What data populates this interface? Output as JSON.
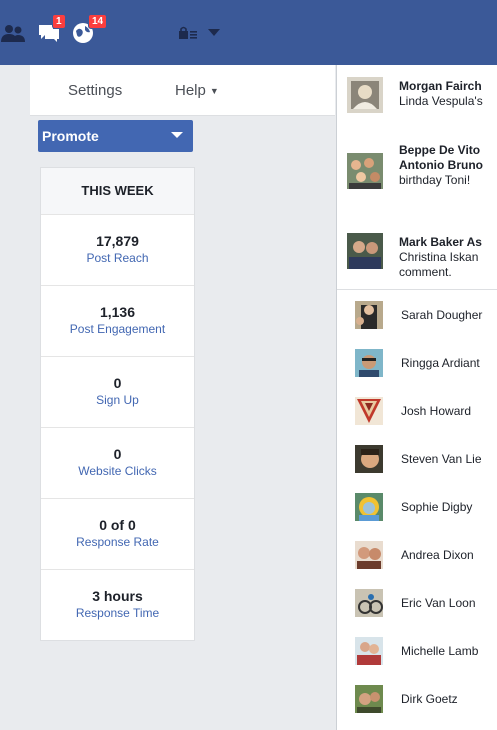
{
  "topbar": {
    "icons": [
      {
        "name": "friends-icon"
      },
      {
        "name": "messages-icon",
        "badge": "1"
      },
      {
        "name": "notifications-icon",
        "badge": "14"
      },
      {
        "name": "privacy-lock-icon"
      },
      {
        "name": "chevron-down-icon"
      }
    ],
    "messages_badge": "1",
    "notifications_badge": "14",
    "bg_color": "#3b5998"
  },
  "menu": {
    "settings": "Settings",
    "help": "Help"
  },
  "promote": {
    "label": "Promote"
  },
  "stats": {
    "heading": "THIS WEEK",
    "items": [
      {
        "value": "17,879",
        "label": "Post Reach"
      },
      {
        "value": "1,136",
        "label": "Post Engagement"
      },
      {
        "value": "0",
        "label": "Sign Up"
      },
      {
        "value": "0",
        "label": "Website Clicks"
      },
      {
        "value": "0 of 0",
        "label": "Response Rate"
      },
      {
        "value": "3 hours",
        "label": "Response Time"
      }
    ]
  },
  "ticker": [
    {
      "title": "Morgan Fairch",
      "sub": "Linda Vespula's"
    },
    {
      "title": "Beppe De Vito",
      "title2": "Antonio Bruno",
      "sub": "birthday Toni!"
    },
    {
      "title": "Mark Baker As",
      "sub": "Christina Iskan",
      "sub2": "comment."
    }
  ],
  "contacts": [
    "Sarah Dougher",
    "Ringga Ardiant",
    "Josh Howard",
    "Steven Van Lie",
    "Sophie Digby",
    "Andrea Dixon",
    "Eric Van Loon",
    "Michelle Lamb",
    "Dirk Goetz"
  ]
}
